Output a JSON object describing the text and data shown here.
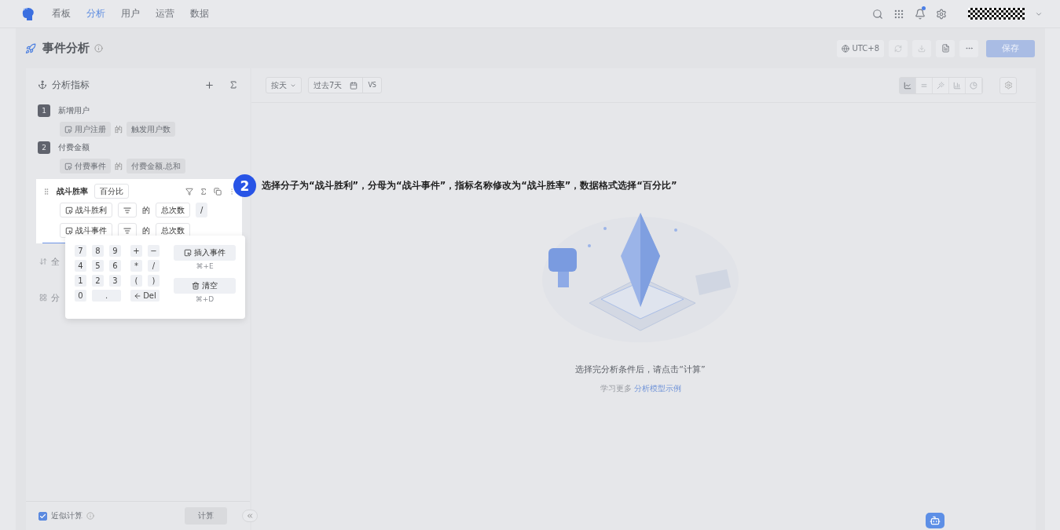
{
  "nav": {
    "tabs": [
      {
        "label": "看板",
        "selected": false
      },
      {
        "label": "分析",
        "selected": true
      },
      {
        "label": "用户",
        "selected": false
      },
      {
        "label": "运营",
        "selected": false
      },
      {
        "label": "数据",
        "selected": false
      }
    ],
    "notification_dot": true
  },
  "header": {
    "title": "事件分析",
    "timezone": "UTC+8",
    "save": "保存"
  },
  "sidebar": {
    "title": "分析指标",
    "metrics": [
      {
        "index": "1",
        "name": "新增用户",
        "event": "用户注册",
        "of": "的",
        "measure": "触发用户数"
      },
      {
        "index": "2",
        "name": "付费金额",
        "event": "付费事件",
        "of": "的",
        "measure": "付费金额.总和"
      }
    ],
    "active_metric": {
      "name": "战斗胜率",
      "format": "百分比",
      "operator": "/",
      "numerator": {
        "event": "战斗胜利",
        "of": "的",
        "measure": "总次数"
      },
      "denominator": {
        "event": "战斗事件",
        "of": "的",
        "measure": "总次数"
      }
    },
    "sections": [
      {
        "kind": "sort",
        "label": "全"
      },
      {
        "kind": "group",
        "label": "分"
      }
    ],
    "approx": {
      "label": "近似计算",
      "checked": true
    },
    "calculate": "计算"
  },
  "keypad": {
    "digits": [
      {
        "key": "7",
        "kind": "key"
      },
      {
        "key": "8",
        "kind": "key"
      },
      {
        "key": "9",
        "kind": "key"
      },
      {
        "key": "4",
        "kind": "key"
      },
      {
        "key": "5",
        "kind": "key"
      },
      {
        "key": "6",
        "kind": "key"
      },
      {
        "key": "1",
        "kind": "key"
      },
      {
        "key": "2",
        "kind": "key"
      },
      {
        "key": "3",
        "kind": "key"
      },
      {
        "key": "0",
        "kind": "key"
      },
      {
        "key": ".",
        "kind": "wide"
      }
    ],
    "operators": [
      {
        "key": "+",
        "kind": "key"
      },
      {
        "key": "−",
        "kind": "key"
      },
      {
        "key": "*",
        "kind": "key"
      },
      {
        "key": "/",
        "kind": "key"
      },
      {
        "key": "(",
        "kind": "key"
      },
      {
        "key": ")",
        "kind": "key"
      },
      {
        "key": "Del",
        "kind": "delete"
      }
    ],
    "insert": {
      "label": "插入事件",
      "shortcut": "⌘+E"
    },
    "clear": {
      "label": "清空",
      "shortcut": "⌘+D"
    }
  },
  "toolbar": {
    "granularity": "按天",
    "range": "过去7天",
    "compare": "VS",
    "chart_types": [
      {
        "kind": "line",
        "selected": true
      },
      {
        "kind": "stack",
        "selected": false
      },
      {
        "kind": "trend",
        "selected": false
      },
      {
        "kind": "bar",
        "selected": false
      },
      {
        "kind": "pie",
        "selected": false
      }
    ]
  },
  "empty_state": {
    "message": "选择完分析条件后，请点击“计算”",
    "learn_more": "学习更多",
    "link": "分析模型示例"
  },
  "step": {
    "number": "2",
    "text": "选择分子为“战斗胜利”，分母为“战斗事件”，指标名称修改为“战斗胜率”，数据格式选择“百分比”"
  }
}
